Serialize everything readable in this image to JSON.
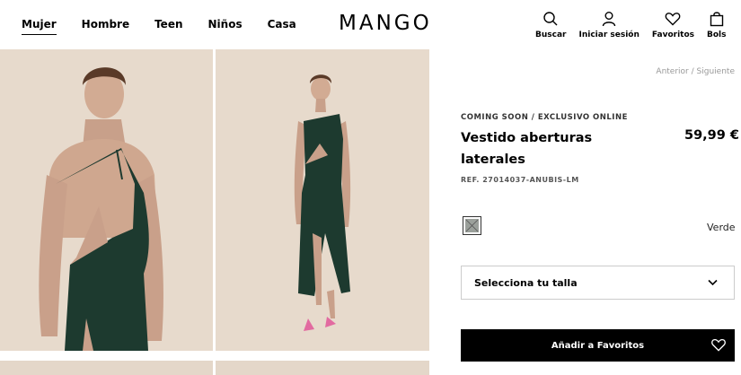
{
  "header": {
    "nav": [
      "Mujer",
      "Hombre",
      "Teen",
      "Niños",
      "Casa"
    ],
    "logo": "MANGO",
    "icons": [
      {
        "label": "Buscar",
        "icon": "search-icon"
      },
      {
        "label": "Iniciar sesión",
        "icon": "user-icon"
      },
      {
        "label": "Favoritos",
        "icon": "heart-icon"
      },
      {
        "label": "Bols",
        "icon": "bag-icon"
      }
    ]
  },
  "breadcrumb": {
    "prev": "Anterior",
    "sep": "/",
    "next": "Siguiente"
  },
  "product": {
    "eyebrow": "COMING SOON / EXCLUSIVO ONLINE",
    "title": "Vestido aberturas laterales",
    "price": "59,99 €",
    "ref": "REF. 27014037-ANUBIS-LM",
    "color_name": "Verde",
    "size_placeholder": "Selecciona tu talla",
    "fav_button": "Añadir a Favoritos"
  },
  "colors": {
    "background": "#e6d9cb",
    "dress": "#1d3a2f",
    "button": "#000000"
  }
}
